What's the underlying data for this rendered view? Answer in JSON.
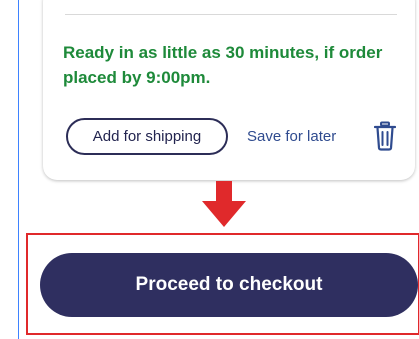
{
  "pickup": {
    "message": "Ready in as little as 30 minutes, if order placed by 9:00pm."
  },
  "actions": {
    "add_for_shipping_label": "Add for shipping",
    "save_for_later_label": "Save for later",
    "delete_icon": "trash-icon"
  },
  "annotation": {
    "arrow_icon": "arrow-down-icon",
    "arrow_color": "#e0292b",
    "highlight_color": "#e0292b"
  },
  "checkout": {
    "button_label": "Proceed to checkout",
    "button_color": "#2f2f60"
  },
  "colors": {
    "success_text": "#1e8a3a",
    "link_text": "#2f4b8f"
  }
}
